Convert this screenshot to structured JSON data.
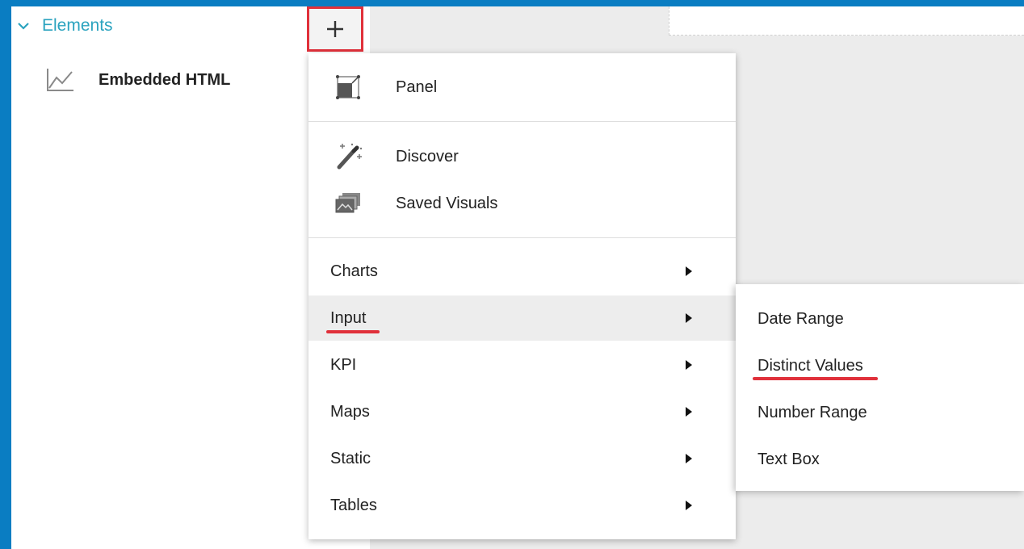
{
  "sidebar": {
    "section_title": "Elements",
    "items": [
      {
        "label": "Embedded HTML",
        "icon": "line-chart-icon"
      }
    ]
  },
  "toolbar": {
    "add_button": {
      "icon": "plus-icon"
    }
  },
  "add_menu": {
    "top_items": [
      {
        "label": "Panel",
        "icon": "panel-icon"
      }
    ],
    "visual_items": [
      {
        "label": "Discover",
        "icon": "magic-wand-icon"
      },
      {
        "label": "Saved Visuals",
        "icon": "saved-visuals-icon"
      }
    ],
    "categories": [
      {
        "label": "Charts",
        "has_submenu": true
      },
      {
        "label": "Input",
        "has_submenu": true,
        "active": true
      },
      {
        "label": "KPI",
        "has_submenu": true
      },
      {
        "label": "Maps",
        "has_submenu": true
      },
      {
        "label": "Static",
        "has_submenu": true
      },
      {
        "label": "Tables",
        "has_submenu": true
      }
    ]
  },
  "input_submenu": {
    "items": [
      {
        "label": "Date Range"
      },
      {
        "label": "Distinct Values"
      },
      {
        "label": "Number Range"
      },
      {
        "label": "Text Box"
      }
    ]
  },
  "colors": {
    "frame_blue": "#0a7dc2",
    "section_teal": "#2ba3bf",
    "highlight_red": "#e0303a",
    "active_row": "#ededed",
    "canvas_gray": "#ececec"
  }
}
